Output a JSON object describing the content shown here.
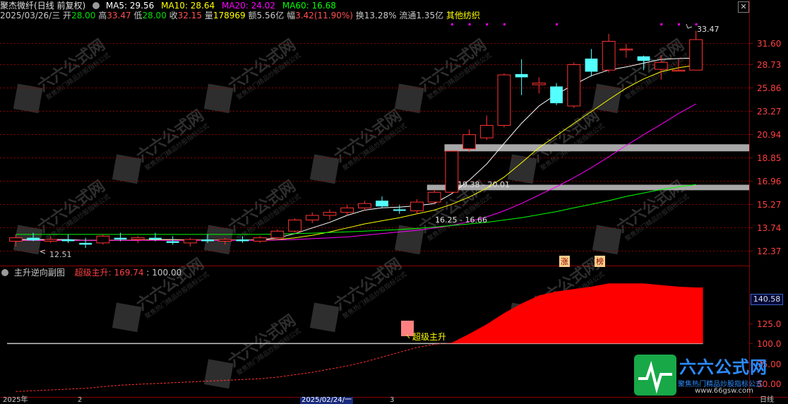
{
  "header": {
    "stock_name": "聚杰微纤",
    "period": "(日线 前复权)",
    "ma": [
      {
        "label": "MA5: 29.56",
        "color": "#ffffff"
      },
      {
        "label": "MA10: 28.64",
        "color": "#ffff00"
      },
      {
        "label": "MA20: 24.02",
        "color": "#ff00ff"
      },
      {
        "label": "MA60: 16.68",
        "color": "#00ff00"
      }
    ]
  },
  "info_line": {
    "date": "2025/03/26/三",
    "open_label": "开",
    "open_value": "28.00",
    "high_label": "高",
    "high_value": "33.47",
    "low_label": "低",
    "low_value": "28.00",
    "close_label": "收",
    "close_value": "32.15",
    "vol_label": "量",
    "vol_value": "178969",
    "amount": "额5.56亿",
    "change_label": "幅",
    "change_value": "3.42(11.90%)",
    "turnover": "换13.28%",
    "float_cap": "流通1.35亿",
    "sector": "其他纺织"
  },
  "price_annotations": {
    "high_mark": "33.47",
    "low_mark": "12.51",
    "zone_upper": "19.38 - 20.01",
    "zone_lower": "16.25 - 16.66",
    "badge_1": "涨",
    "badge_2": "榜"
  },
  "sub_panel": {
    "title": "主升逆向副图",
    "indicator_label": "超级主升:",
    "indicator_value": "169.74",
    "ref_value": ": 100.00",
    "annotation": "超级主升",
    "current_value": "140.58"
  },
  "x_axis": {
    "labels": [
      "2025年",
      "2",
      "2025/02/24/一",
      "3"
    ],
    "period_label": "日线"
  },
  "colors": {
    "up": "#ff3232",
    "down": "#54ffff",
    "ma5": "#ffffff",
    "ma10": "#ffff00",
    "ma20": "#ff00ff",
    "ma60": "#00ff00",
    "zone": "#a8a8a8",
    "fill": "#ff0000",
    "watermark_brand": "#2b8cff"
  },
  "watermark": {
    "brand": "六六公式网",
    "slogan": "聚焦热门精品炒股指标公式",
    "url": "www.66gsw.com"
  },
  "chart_data": [
    {
      "type": "candlestick",
      "title": "聚杰微纤 (日线 前复权)",
      "y_ticks": [
        "31.60",
        "28.73",
        "25.86",
        "23.27",
        "20.94",
        "18.85",
        "16.96",
        "15.27",
        "13.74",
        "12.37"
      ],
      "ylim": [
        11.7,
        34.5
      ],
      "log_scale": true,
      "candles": [
        {
          "o": 12.9,
          "h": 13.3,
          "l": 12.6,
          "c": 13.1
        },
        {
          "o": 13.1,
          "h": 13.4,
          "l": 12.9,
          "c": 12.95
        },
        {
          "o": 12.9,
          "h": 13.2,
          "l": 12.8,
          "c": 13.0
        },
        {
          "o": 13.0,
          "h": 13.3,
          "l": 12.8,
          "c": 12.9
        },
        {
          "o": 12.8,
          "h": 13.1,
          "l": 12.51,
          "c": 12.7
        },
        {
          "o": 12.8,
          "h": 13.3,
          "l": 12.7,
          "c": 13.2
        },
        {
          "o": 13.1,
          "h": 13.4,
          "l": 12.9,
          "c": 13.0
        },
        {
          "o": 13.0,
          "h": 13.2,
          "l": 12.8,
          "c": 13.1
        },
        {
          "o": 13.1,
          "h": 13.4,
          "l": 12.9,
          "c": 13.0
        },
        {
          "o": 12.9,
          "h": 13.2,
          "l": 12.7,
          "c": 12.8
        },
        {
          "o": 12.8,
          "h": 13.1,
          "l": 12.6,
          "c": 13.0
        },
        {
          "o": 13.0,
          "h": 13.3,
          "l": 12.8,
          "c": 12.9
        },
        {
          "o": 12.9,
          "h": 13.1,
          "l": 12.7,
          "c": 13.0
        },
        {
          "o": 13.0,
          "h": 13.2,
          "l": 12.8,
          "c": 12.9
        },
        {
          "o": 12.9,
          "h": 13.2,
          "l": 12.8,
          "c": 13.1
        },
        {
          "o": 13.1,
          "h": 13.6,
          "l": 13.0,
          "c": 13.5
        },
        {
          "o": 13.5,
          "h": 14.3,
          "l": 13.4,
          "c": 14.2
        },
        {
          "o": 14.2,
          "h": 14.7,
          "l": 14.0,
          "c": 14.5
        },
        {
          "o": 14.5,
          "h": 14.9,
          "l": 14.2,
          "c": 14.7
        },
        {
          "o": 14.7,
          "h": 15.2,
          "l": 14.5,
          "c": 15.0
        },
        {
          "o": 15.0,
          "h": 15.5,
          "l": 14.8,
          "c": 15.3
        },
        {
          "o": 15.5,
          "h": 15.8,
          "l": 15.0,
          "c": 15.1
        },
        {
          "o": 14.9,
          "h": 15.2,
          "l": 14.6,
          "c": 14.8
        },
        {
          "o": 14.8,
          "h": 15.6,
          "l": 14.6,
          "c": 15.4
        },
        {
          "o": 15.4,
          "h": 16.3,
          "l": 15.3,
          "c": 16.1
        },
        {
          "o": 16.1,
          "h": 19.4,
          "l": 16.0,
          "c": 19.4
        },
        {
          "o": 19.6,
          "h": 21.4,
          "l": 19.3,
          "c": 20.9
        },
        {
          "o": 20.6,
          "h": 22.8,
          "l": 20.4,
          "c": 21.8
        },
        {
          "o": 21.8,
          "h": 27.6,
          "l": 21.6,
          "c": 27.4
        },
        {
          "o": 27.5,
          "h": 29.4,
          "l": 25.0,
          "c": 27.1
        },
        {
          "o": 26.2,
          "h": 27.1,
          "l": 25.2,
          "c": 26.4
        },
        {
          "o": 26.0,
          "h": 26.4,
          "l": 23.9,
          "c": 24.1
        },
        {
          "o": 23.8,
          "h": 29.0,
          "l": 23.6,
          "c": 28.7
        },
        {
          "o": 29.5,
          "h": 30.8,
          "l": 27.2,
          "c": 27.8
        },
        {
          "o": 28.0,
          "h": 33.0,
          "l": 27.7,
          "c": 31.9
        },
        {
          "o": 30.8,
          "h": 31.5,
          "l": 29.6,
          "c": 30.8
        },
        {
          "o": 29.8,
          "h": 29.9,
          "l": 28.0,
          "c": 29.2
        },
        {
          "o": 28.1,
          "h": 30.0,
          "l": 26.8,
          "c": 29.0
        },
        {
          "o": 28.0,
          "h": 29.5,
          "l": 28.0,
          "c": 28.0
        },
        {
          "o": 28.0,
          "h": 33.47,
          "l": 28.0,
          "c": 32.15
        }
      ],
      "ma": [
        {
          "name": "MA5",
          "color": "#ffffff",
          "values": [
            13.0,
            13.0,
            13.0,
            13.0,
            12.95,
            12.95,
            12.95,
            12.95,
            13.0,
            13.0,
            12.97,
            12.96,
            12.96,
            12.96,
            12.98,
            13.1,
            13.35,
            13.7,
            14.05,
            14.5,
            14.85,
            15.0,
            15.05,
            15.15,
            15.3,
            16.0,
            17.0,
            18.3,
            20.1,
            22.0,
            23.8,
            25.1,
            26.2,
            27.3,
            28.0,
            28.4,
            28.9,
            29.4,
            29.5,
            29.56
          ]
        },
        {
          "name": "MA10",
          "color": "#ffff00",
          "values": [
            12.95,
            12.95,
            12.95,
            12.95,
            12.95,
            12.95,
            12.95,
            12.96,
            12.97,
            12.97,
            12.97,
            12.97,
            12.97,
            12.97,
            12.97,
            13.0,
            13.1,
            13.25,
            13.45,
            13.7,
            13.95,
            14.15,
            14.35,
            14.6,
            14.85,
            15.25,
            15.75,
            16.4,
            17.25,
            18.4,
            19.7,
            20.8,
            22.0,
            23.2,
            24.5,
            25.8,
            26.9,
            27.8,
            28.3,
            28.64
          ]
        },
        {
          "name": "MA20",
          "color": "#ff00ff",
          "values": [
            12.95,
            12.95,
            12.95,
            12.95,
            12.95,
            12.95,
            12.95,
            12.95,
            12.95,
            12.95,
            12.95,
            12.95,
            12.95,
            12.95,
            12.95,
            12.97,
            13.0,
            13.05,
            13.1,
            13.15,
            13.25,
            13.35,
            13.45,
            13.55,
            13.7,
            13.85,
            14.1,
            14.4,
            14.8,
            15.3,
            15.9,
            16.5,
            17.2,
            18.0,
            18.9,
            19.9,
            20.9,
            21.9,
            23.0,
            24.02
          ]
        },
        {
          "name": "MA60",
          "color": "#00ff00",
          "values": [
            13.3,
            13.3,
            13.3,
            13.3,
            13.3,
            13.3,
            13.3,
            13.3,
            13.3,
            13.3,
            13.3,
            13.3,
            13.3,
            13.3,
            13.3,
            13.32,
            13.35,
            13.38,
            13.42,
            13.46,
            13.5,
            13.55,
            13.6,
            13.67,
            13.75,
            13.85,
            13.95,
            14.05,
            14.2,
            14.35,
            14.55,
            14.75,
            15.0,
            15.25,
            15.5,
            15.8,
            16.05,
            16.3,
            16.5,
            16.68
          ]
        }
      ],
      "zones": [
        {
          "low": 19.38,
          "high": 20.01,
          "label": "19.38 - 20.01"
        },
        {
          "low": 16.25,
          "high": 16.66,
          "label": "16.25 - 16.66"
        }
      ]
    },
    {
      "type": "area",
      "title": "主升逆向副图",
      "series_name": "超级主升",
      "y_ticks": [
        "140.58",
        "125.0",
        "100.0",
        "75.00",
        "50.00"
      ],
      "ylim": [
        35,
        185
      ],
      "reference": 100,
      "values": [
        40,
        41,
        42,
        43,
        44,
        46,
        48,
        49,
        50,
        51,
        52,
        53,
        54,
        55,
        56,
        58,
        61,
        64,
        68,
        72,
        77,
        83,
        89,
        95,
        99,
        101,
        112,
        124,
        138,
        150,
        160,
        165,
        168,
        171,
        175,
        175,
        175,
        173,
        171,
        170
      ]
    }
  ]
}
